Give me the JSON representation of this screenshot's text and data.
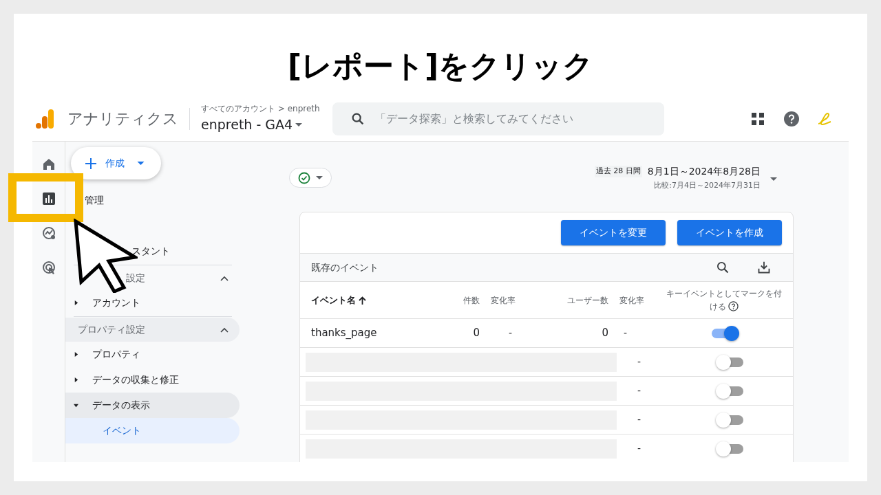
{
  "slide_title": "[レポート]をクリック",
  "header": {
    "product": "アナリティクス",
    "breadcrumb": "すべてのアカウント > enpreth",
    "property": "enpreth - GA4",
    "search": {
      "placeholder": "「データ探索」と検索してみてください"
    }
  },
  "rail": [
    {
      "kind": "home",
      "highlighted": false
    },
    {
      "kind": "reports",
      "highlighted": true
    },
    {
      "kind": "explore",
      "highlighted": false
    },
    {
      "kind": "advertising",
      "highlighted": false
    }
  ],
  "create_button": "作成",
  "sidebar": [
    {
      "kind": "link",
      "label": "管理"
    },
    {
      "kind": "blank"
    },
    {
      "kind": "link",
      "label": "スタント"
    },
    {
      "kind": "section",
      "label": "設定",
      "expanded": true,
      "shaded": false,
      "children": [
        {
          "label": "アカウント",
          "expanded": false,
          "selected": false
        }
      ]
    },
    {
      "kind": "section",
      "label": "プロパティ設定",
      "expanded": true,
      "shaded": true,
      "children": [
        {
          "label": "プロパティ",
          "expanded": false,
          "selected": false
        },
        {
          "label": "データの収集と修正",
          "expanded": false,
          "selected": false
        },
        {
          "label": "データの表示",
          "expanded": true,
          "selected": false,
          "children": [
            {
              "label": "イベント",
              "selected": true
            }
          ]
        }
      ]
    }
  ],
  "date_range": {
    "preset": "過去 28 日間",
    "range": "8月1日～2024年8月28日",
    "compare": "比較:7月4日～2024年7月31日"
  },
  "actions": [
    "イベントを変更",
    "イベントを作成"
  ],
  "table": {
    "title": "既存のイベント",
    "columns": [
      "イベント名",
      "件数",
      "変化率",
      "ユーザー数",
      "変化率",
      "キーイベントとしてマークを付ける"
    ],
    "rows": [
      {
        "kind": "data",
        "cells": [
          "thanks_page",
          "0",
          "-",
          "0",
          "-"
        ],
        "on": true
      },
      {
        "kind": "redacted",
        "change": "-",
        "on": false
      },
      {
        "kind": "redacted",
        "change": "-",
        "on": false
      },
      {
        "kind": "redacted",
        "change": "-",
        "on": false
      },
      {
        "kind": "redacted",
        "change": "-",
        "on": false
      }
    ]
  }
}
